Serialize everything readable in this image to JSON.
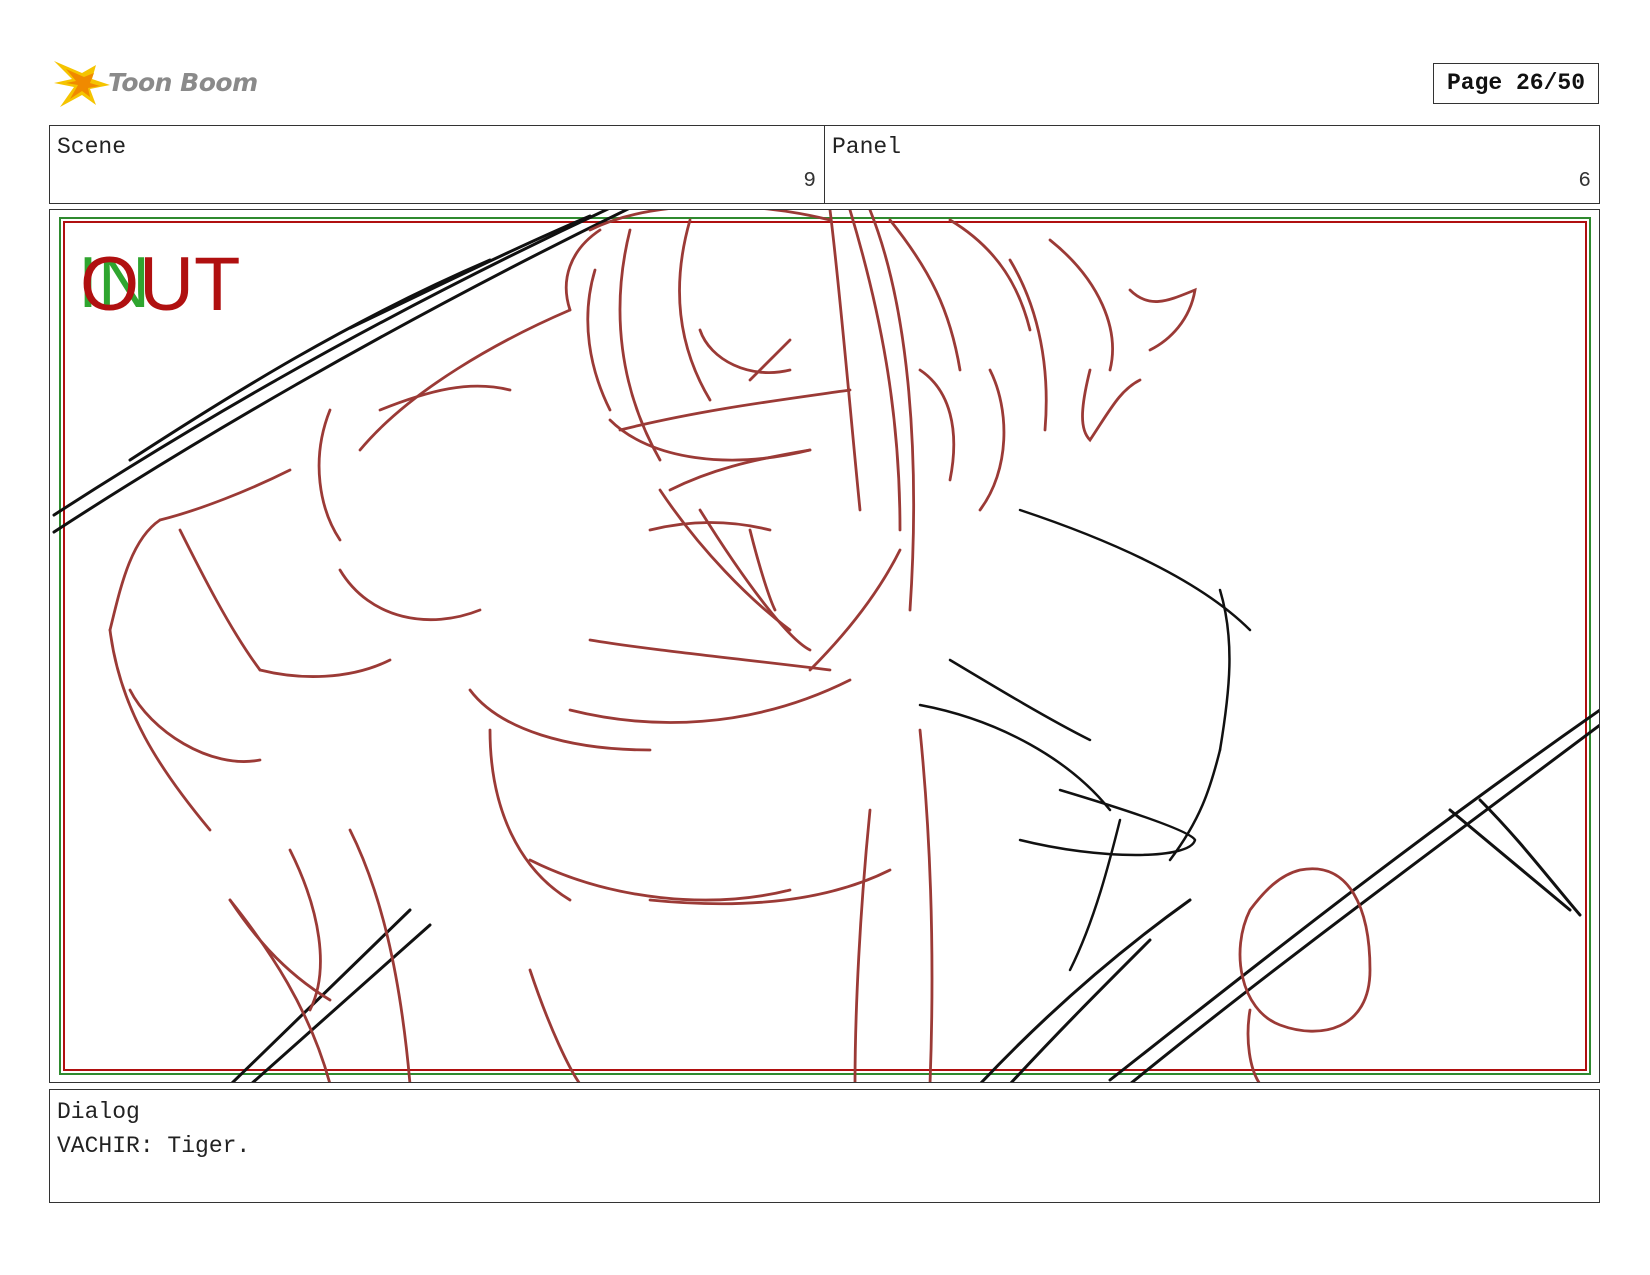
{
  "header": {
    "logo_text": "Toon Boom",
    "page_label": "Page 26/50"
  },
  "scene": {
    "label": "Scene",
    "value": "9"
  },
  "panel": {
    "label": "Panel",
    "value": "6"
  },
  "frame_markers": {
    "in_label": "IN",
    "out_label": "OUT"
  },
  "dialog": {
    "label": "Dialog",
    "text": "VACHIR: Tiger."
  },
  "colors": {
    "sketch_red": "#9b3a36",
    "ink_black": "#111111",
    "frame_green": "#2f8a2f",
    "frame_red": "#b01010",
    "logo_yellow": "#f5c400"
  }
}
